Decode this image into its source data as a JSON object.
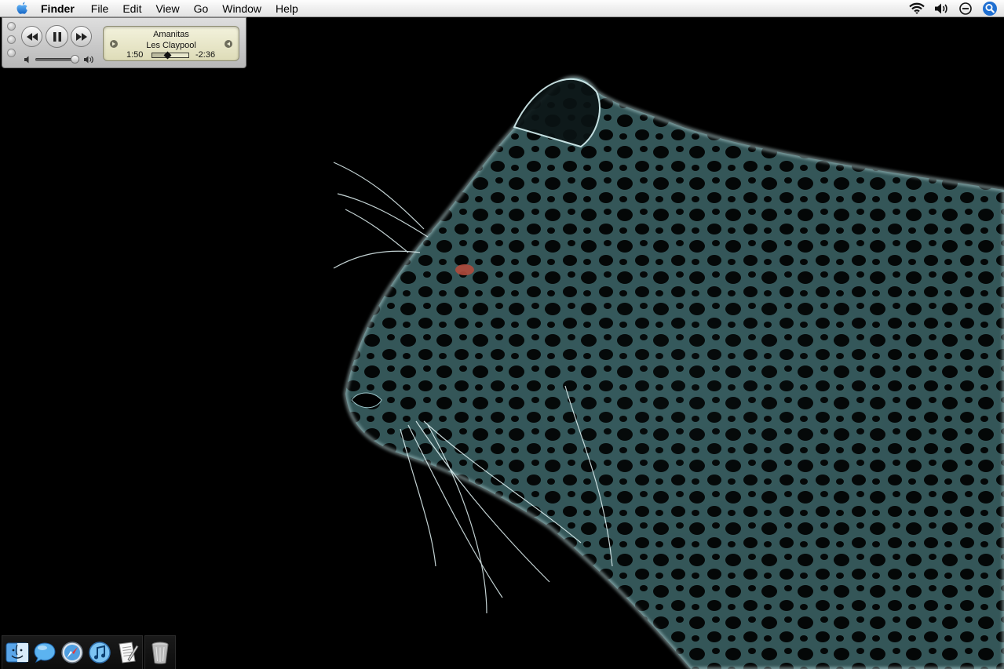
{
  "menubar": {
    "apple_icon": "apple-icon",
    "app_name": "Finder",
    "items": [
      "File",
      "Edit",
      "View",
      "Go",
      "Window",
      "Help"
    ],
    "status_icons": [
      "wifi-icon",
      "volume-icon",
      "time-machine-icon",
      "spotlight-icon"
    ]
  },
  "mini_player": {
    "buttons": [
      "previous-track-icon",
      "pause-icon",
      "next-track-icon"
    ],
    "track_title": "Amanitas",
    "artist": "Les Claypool",
    "elapsed": "1:50",
    "remaining": "-2:36",
    "progress_fraction": 0.43,
    "volume_fraction": 0.9
  },
  "dock": {
    "apps": [
      "finder-icon",
      "ichat-icon",
      "safari-icon",
      "itunes-icon",
      "textedit-icon"
    ],
    "trash": "trash-icon"
  },
  "desktop": {
    "wallpaper": "fractal-leopard-wallpaper",
    "colors": {
      "glow": "#a8d4d8",
      "eye": "#b04a3c",
      "background": "#000000"
    }
  }
}
